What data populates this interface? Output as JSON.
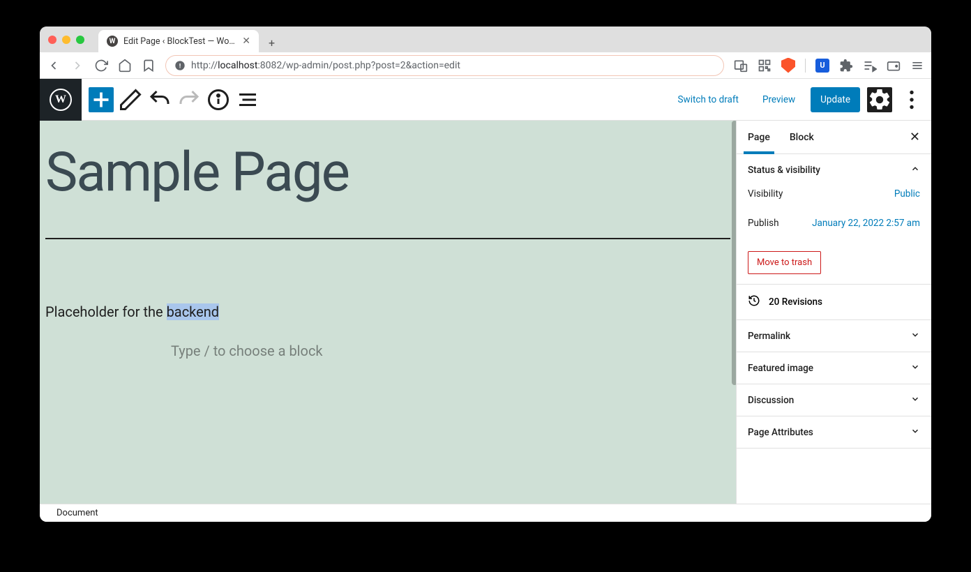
{
  "browser": {
    "tab_title": "Edit Page ‹ BlockTest — WordPr",
    "url_prefix": "http://",
    "url_host": "localhost",
    "url_path": ":8082/wp-admin/post.php?post=2&action=edit"
  },
  "toolbar": {
    "switch_draft": "Switch to draft",
    "preview": "Preview",
    "update": "Update"
  },
  "editor": {
    "title": "Sample Page",
    "paragraph_before": "Placeholder for the ",
    "paragraph_selected": "backend",
    "block_placeholder": "Type / to choose a block"
  },
  "sidebar": {
    "tab_page": "Page",
    "tab_block": "Block",
    "status_header": "Status & visibility",
    "visibility_label": "Visibility",
    "visibility_value": "Public",
    "publish_label": "Publish",
    "publish_value": "January 22, 2022 2:57 am",
    "trash": "Move to trash",
    "revisions": "20 Revisions",
    "permalink": "Permalink",
    "featured": "Featured image",
    "discussion": "Discussion",
    "attributes": "Page Attributes"
  },
  "statusbar": {
    "breadcrumb": "Document"
  }
}
